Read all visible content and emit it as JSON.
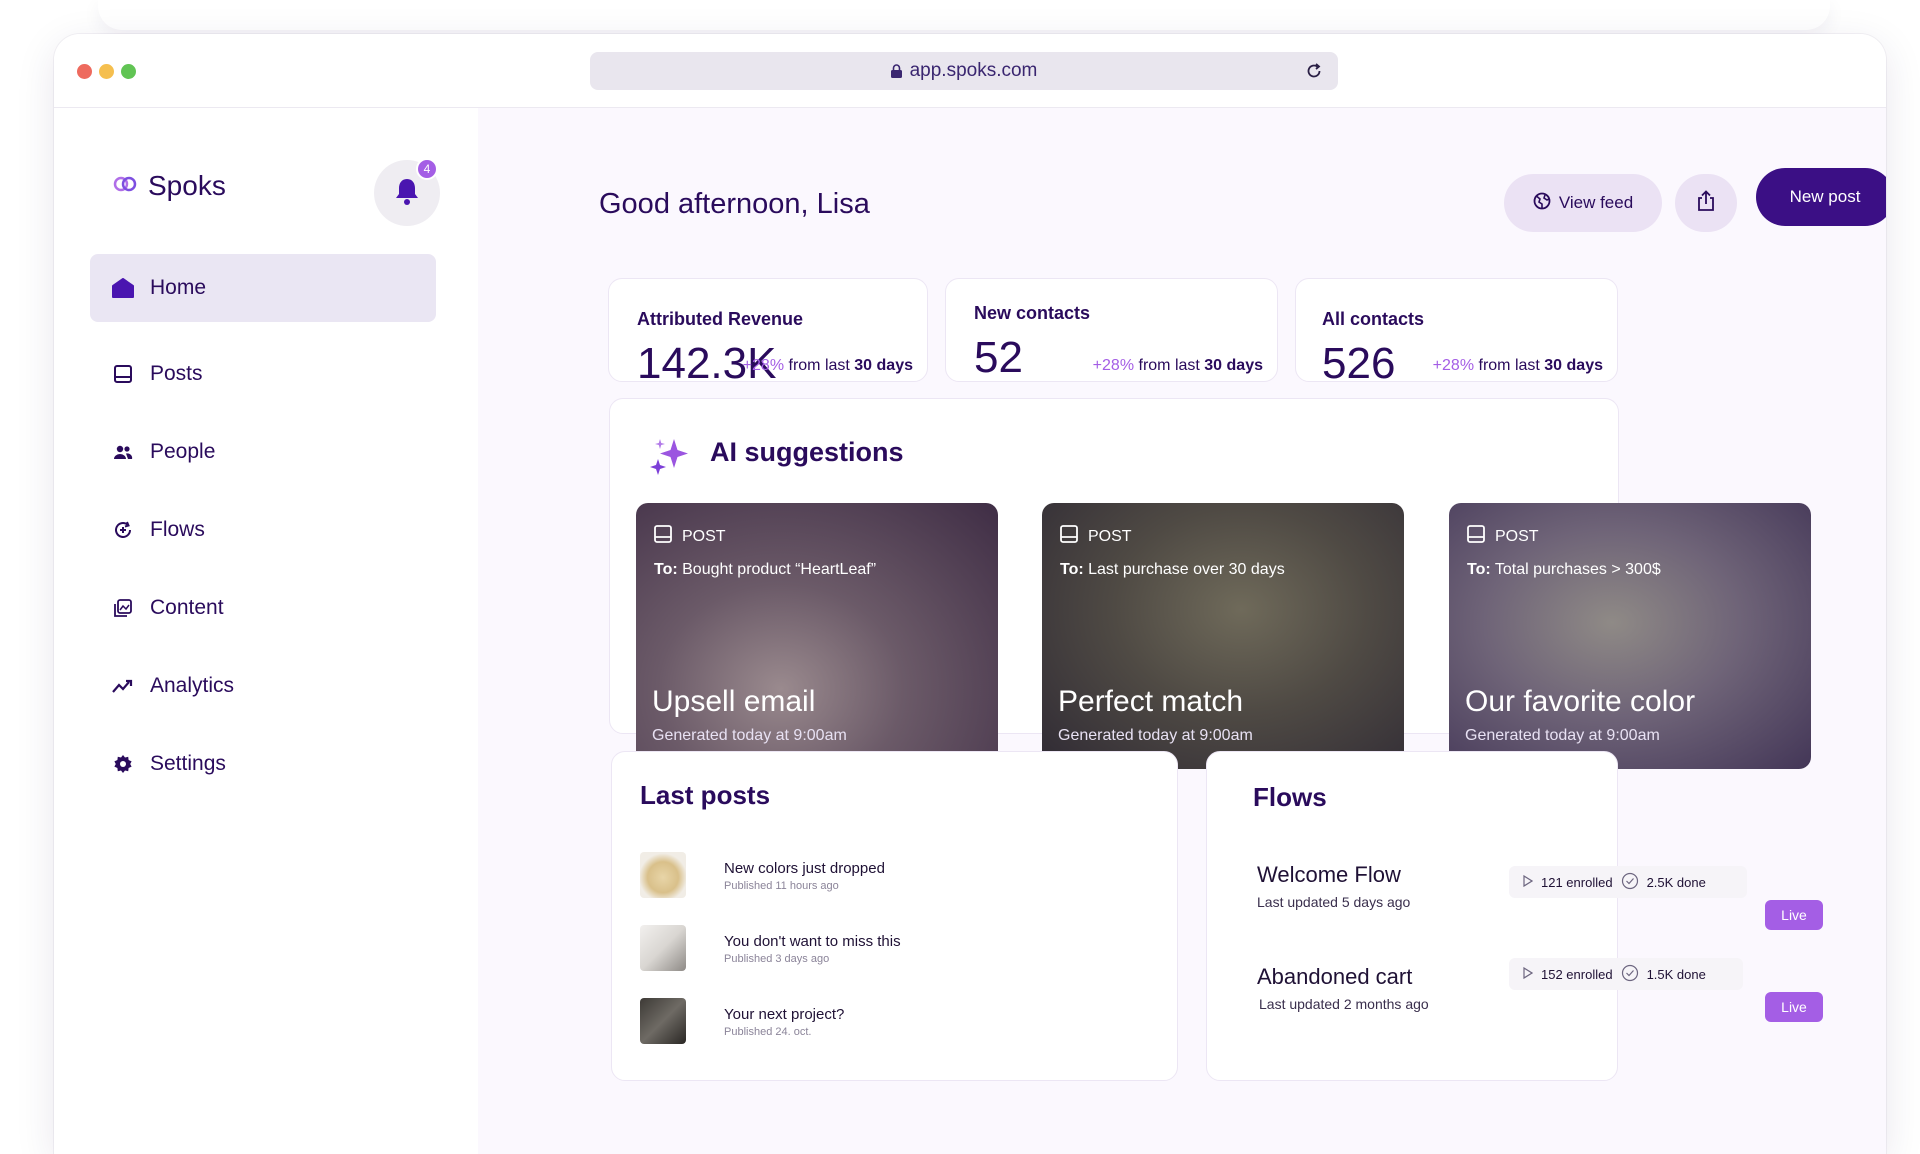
{
  "browser": {
    "url": "app.spoks.com"
  },
  "brand": {
    "name": "Spoks",
    "notifications": "4"
  },
  "nav": [
    {
      "label": "Home",
      "icon": "home-icon"
    },
    {
      "label": "Posts",
      "icon": "posts-icon"
    },
    {
      "label": "People",
      "icon": "people-icon"
    },
    {
      "label": "Flows",
      "icon": "flows-icon"
    },
    {
      "label": "Content",
      "icon": "content-icon"
    },
    {
      "label": "Analytics",
      "icon": "analytics-icon"
    },
    {
      "label": "Settings",
      "icon": "settings-icon"
    }
  ],
  "header": {
    "greeting": "Good afternoon, Lisa",
    "view_feed": "View feed",
    "new_post": "New post"
  },
  "stats": [
    {
      "label": "Attributed Revenue",
      "value": "142.3K",
      "pct": "+28%",
      "text": " from last ",
      "bold": "30 days"
    },
    {
      "label": "New contacts",
      "value": "52",
      "pct": "+28%",
      "text": " from last ",
      "bold": "30 days"
    },
    {
      "label": "All contacts",
      "value": "526",
      "pct": "+28%",
      "text": " from last ",
      "bold": "30 days"
    }
  ],
  "ai": {
    "title": "AI suggestions",
    "cards": [
      {
        "type": "POST",
        "to_label": "To:",
        "to": " Bought product “HeartLeaf”",
        "title": "Upsell email",
        "generated": "Generated today at 9:00am"
      },
      {
        "type": "POST",
        "to_label": "To:",
        "to": " Last purchase over 30 days",
        "title": "Perfect match",
        "generated": "Generated today at 9:00am"
      },
      {
        "type": "POST",
        "to_label": "To:",
        "to": " Total purchases > 300$",
        "title": "Our favorite color",
        "generated": "Generated today at 9:00am"
      }
    ]
  },
  "last_posts": {
    "title": "Last posts",
    "items": [
      {
        "title": "New colors just dropped",
        "sub": "Published 11 hours ago"
      },
      {
        "title": "You don't want to miss this",
        "sub": "Published 3 days ago"
      },
      {
        "title": "Your next project?",
        "sub": "Published 24. oct."
      }
    ]
  },
  "flows": {
    "title": "Flows",
    "items": [
      {
        "name": "Welcome Flow",
        "sub": "Last updated 5 days ago",
        "enrolled": "121 enrolled",
        "done": "2.5K done",
        "status": "Live"
      },
      {
        "name": "Abandoned cart",
        "sub": "Last updated 2 months ago",
        "enrolled": "152 enrolled",
        "done": "1.5K done",
        "status": "Live"
      }
    ]
  },
  "colors": {
    "primary": "#2a0b5c",
    "accent": "#a45ee5",
    "button_dark": "#3b0f85",
    "soft": "#ebe2f4"
  }
}
